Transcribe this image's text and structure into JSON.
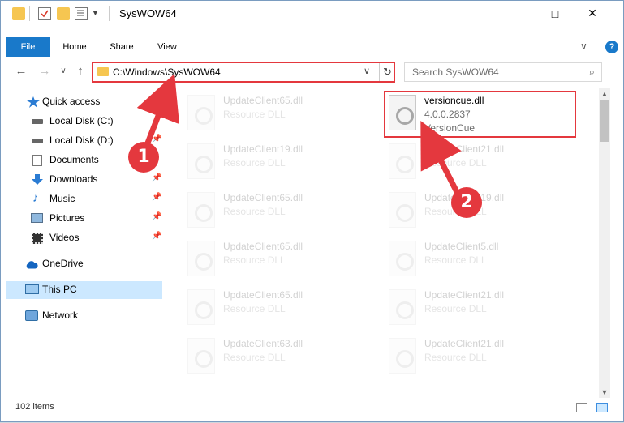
{
  "window": {
    "title": "SysWOW64",
    "minimize": "—",
    "maximize": "□",
    "close": "✕"
  },
  "ribbon": {
    "tabs": [
      "File",
      "Home",
      "Share",
      "View"
    ],
    "expand": "∨",
    "help": "?"
  },
  "nav": {
    "back": "←",
    "forward": "→",
    "recent": "∨",
    "up": "↑",
    "address": "C:\\Windows\\SysWOW64",
    "address_dropdown": "∨",
    "refresh": "↻",
    "search_placeholder": "Search SysWOW64",
    "search_icon": "⌕"
  },
  "sidebar": {
    "items": [
      {
        "label": "Quick access",
        "icon": "star-icon"
      },
      {
        "label": "Local Disk (C:)",
        "icon": "drive-icon"
      },
      {
        "label": "Local Disk (D:)",
        "icon": "drive-icon"
      },
      {
        "label": "Documents",
        "icon": "documents-icon"
      },
      {
        "label": "Downloads",
        "icon": "download-icon"
      },
      {
        "label": "Music",
        "icon": "music-icon"
      },
      {
        "label": "Pictures",
        "icon": "pictures-icon"
      },
      {
        "label": "Videos",
        "icon": "videos-icon"
      },
      {
        "label": "OneDrive",
        "icon": "cloud-icon"
      },
      {
        "label": "This PC",
        "icon": "pc-icon"
      },
      {
        "label": "Network",
        "icon": "network-icon"
      }
    ],
    "pin_glyph": "📌"
  },
  "files": {
    "left_column": [
      {
        "name": "UpdateClient65.dll",
        "desc": "Resource DLL"
      },
      {
        "name": "UpdateClient19.dll",
        "desc": "Resource DLL"
      },
      {
        "name": "UpdateClient65.dll",
        "desc": "Resource DLL"
      },
      {
        "name": "UpdateClient65.dll",
        "desc": "Resource DLL"
      },
      {
        "name": "UpdateClient65.dll",
        "desc": "Resource DLL"
      },
      {
        "name": "UpdateClient63.dll",
        "desc": "Resource DLL"
      }
    ],
    "right_column": [
      {
        "name": "versioncue.dll",
        "version": "4.0.0.2837",
        "desc": "VersionCue"
      },
      {
        "name": "UpdateClient21.dll",
        "desc": "Resource DLL"
      },
      {
        "name": "UpdateClient19.dll",
        "desc": "Resource DLL"
      },
      {
        "name": "UpdateClient5.dll",
        "desc": "Resource DLL"
      },
      {
        "name": "UpdateClient21.dll",
        "desc": "Resource DLL"
      },
      {
        "name": "UpdateClient21.dll",
        "desc": "Resource DLL"
      }
    ]
  },
  "scrollbar": {
    "up": "▲",
    "down": "▼"
  },
  "status": {
    "item_count": "102 items"
  },
  "annotations": {
    "step1": "1",
    "step2": "2"
  },
  "colors": {
    "accent": "#1979ca",
    "highlight": "#e4383e",
    "selection": "#cce8ff",
    "folder": "#f6c651"
  }
}
